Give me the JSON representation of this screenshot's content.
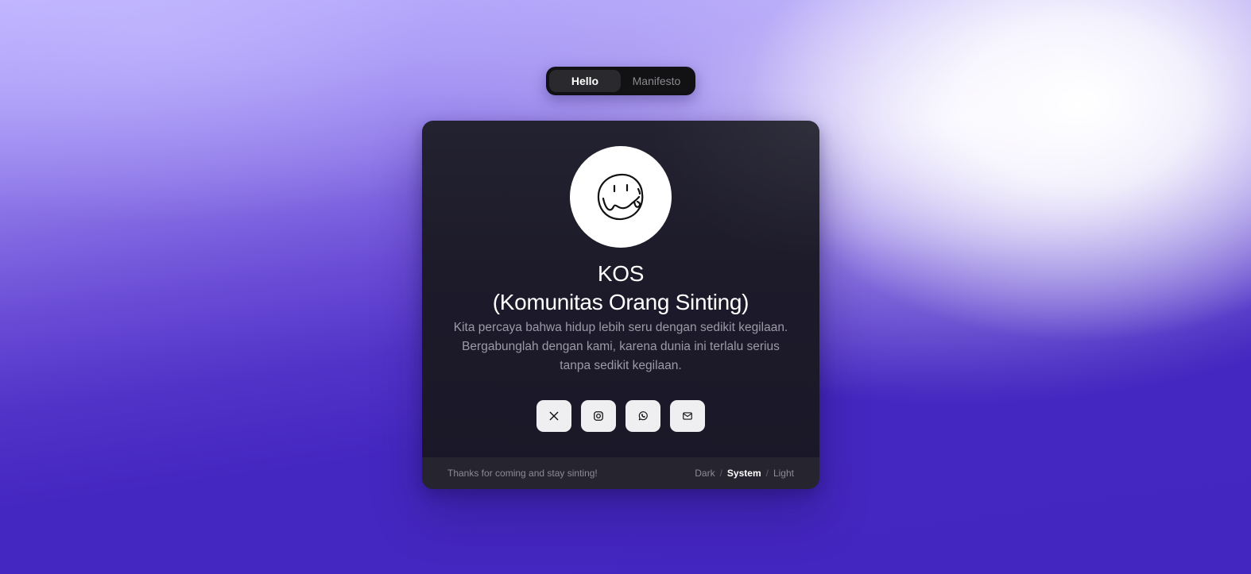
{
  "tabs": [
    {
      "label": "Hello",
      "active": true
    },
    {
      "label": "Manifesto",
      "active": false
    }
  ],
  "profile": {
    "avatar_icon": "smiley-face-icon",
    "title_line1": "KOS",
    "title_line2": "(Komunitas Orang Sinting)",
    "description": "Kita percaya bahwa hidup lebih seru dengan sedikit kegilaan. Bergabunglah dengan kami, karena dunia ini terlalu serius tanpa sedikit kegilaan."
  },
  "socials": [
    {
      "icon": "x-twitter-icon"
    },
    {
      "icon": "instagram-icon"
    },
    {
      "icon": "whatsapp-icon"
    },
    {
      "icon": "email-icon"
    }
  ],
  "footer": {
    "note": "Thanks for coming and stay sinting!",
    "theme": {
      "options": [
        "Dark",
        "System",
        "Light"
      ],
      "separator": "/",
      "selected": "System"
    }
  },
  "colors": {
    "background_primary": "#4427c0",
    "background_top": "#bdb1ff",
    "card": "#1d1b2a",
    "footer": "#25242f",
    "tabs_bg": "#121214"
  }
}
